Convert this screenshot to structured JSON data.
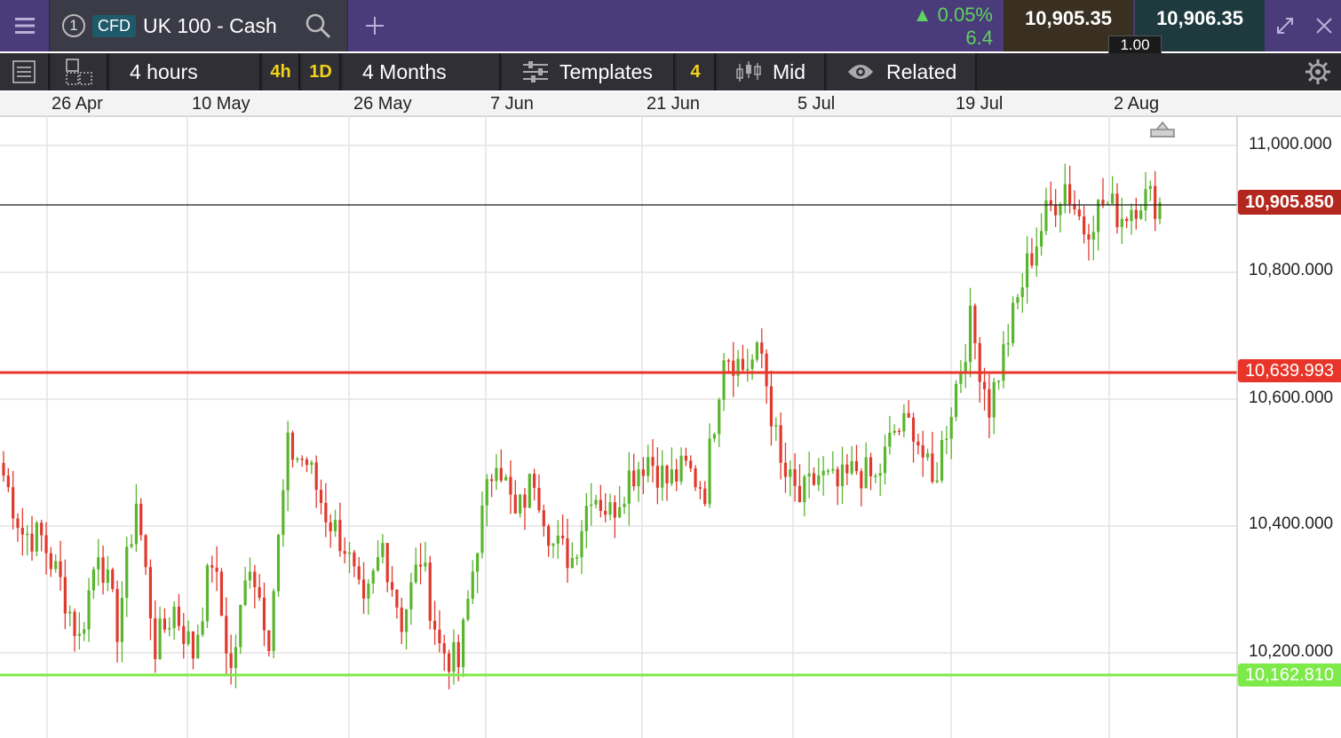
{
  "header": {
    "instrument_number": "1",
    "type_badge": "CFD",
    "instrument_name": "UK 100 - Cash",
    "change_percent": "▲ 0.05%",
    "change_points": "6.4",
    "sell_price": "10,905.35",
    "buy_price": "10,906.35",
    "spread": "1.00",
    "icons": [
      "hamburger-menu-icon",
      "search-icon",
      "plus-icon",
      "expand-icon",
      "close-icon"
    ]
  },
  "toolbar": {
    "interval_label": "4 hours",
    "interval_4h": "4h",
    "interval_1d": "1D",
    "range_label": "4 Months",
    "templates_label": "Templates",
    "templates_count": "4",
    "price_type_label": "Mid",
    "related_label": "Related"
  },
  "time_axis": {
    "labels": [
      "26 Apr",
      "10 May",
      "26 May",
      "7 Jun",
      "21 Jun",
      "5 Jul",
      "19 Jul",
      "2 Aug"
    ]
  },
  "price_axis": {
    "labels": [
      "11,000.000",
      "10,800.000",
      "10,600.000",
      "10,400.000",
      "10,200.000"
    ]
  },
  "price_lines": {
    "current": "10,905.850",
    "resistance": "10,639.993",
    "support": "10,162.810"
  },
  "colors": {
    "up": "#5ab52e",
    "down": "#e03a2e",
    "resistance": "#e8352a",
    "support": "#7dea4a",
    "current_tag": "#b3271e",
    "header_bg": "#4a3b7a"
  },
  "chart_data": {
    "type": "candlestick",
    "interval": "4h",
    "ylim": [
      10100,
      11030
    ],
    "anchors": [
      [
        0,
        10480
      ],
      [
        4,
        10390
      ],
      [
        8,
        10380
      ],
      [
        12,
        10310
      ],
      [
        16,
        10220
      ],
      [
        20,
        10370
      ],
      [
        24,
        10240
      ],
      [
        28,
        10440
      ],
      [
        32,
        10210
      ],
      [
        36,
        10270
      ],
      [
        40,
        10200
      ],
      [
        44,
        10350
      ],
      [
        48,
        10170
      ],
      [
        52,
        10350
      ],
      [
        56,
        10230
      ],
      [
        60,
        10520
      ],
      [
        64,
        10500
      ],
      [
        68,
        10420
      ],
      [
        72,
        10370
      ],
      [
        76,
        10260
      ],
      [
        80,
        10370
      ],
      [
        84,
        10250
      ],
      [
        88,
        10350
      ],
      [
        92,
        10210
      ],
      [
        96,
        10180
      ],
      [
        100,
        10380
      ],
      [
        104,
        10520
      ],
      [
        108,
        10410
      ],
      [
        112,
        10480
      ],
      [
        116,
        10370
      ],
      [
        120,
        10350
      ],
      [
        124,
        10460
      ],
      [
        128,
        10420
      ],
      [
        132,
        10480
      ],
      [
        136,
        10510
      ],
      [
        140,
        10470
      ],
      [
        144,
        10490
      ],
      [
        148,
        10460
      ],
      [
        152,
        10680
      ],
      [
        156,
        10650
      ],
      [
        160,
        10670
      ],
      [
        164,
        10490
      ],
      [
        168,
        10440
      ],
      [
        172,
        10480
      ],
      [
        176,
        10460
      ],
      [
        180,
        10490
      ],
      [
        184,
        10470
      ],
      [
        188,
        10550
      ],
      [
        192,
        10560
      ],
      [
        196,
        10460
      ],
      [
        200,
        10590
      ],
      [
        204,
        10720
      ],
      [
        208,
        10590
      ],
      [
        212,
        10700
      ],
      [
        216,
        10810
      ],
      [
        220,
        10890
      ],
      [
        224,
        10940
      ],
      [
        228,
        10870
      ],
      [
        232,
        10910
      ],
      [
        236,
        10890
      ],
      [
        240,
        10920
      ],
      [
        244,
        10910
      ]
    ]
  }
}
